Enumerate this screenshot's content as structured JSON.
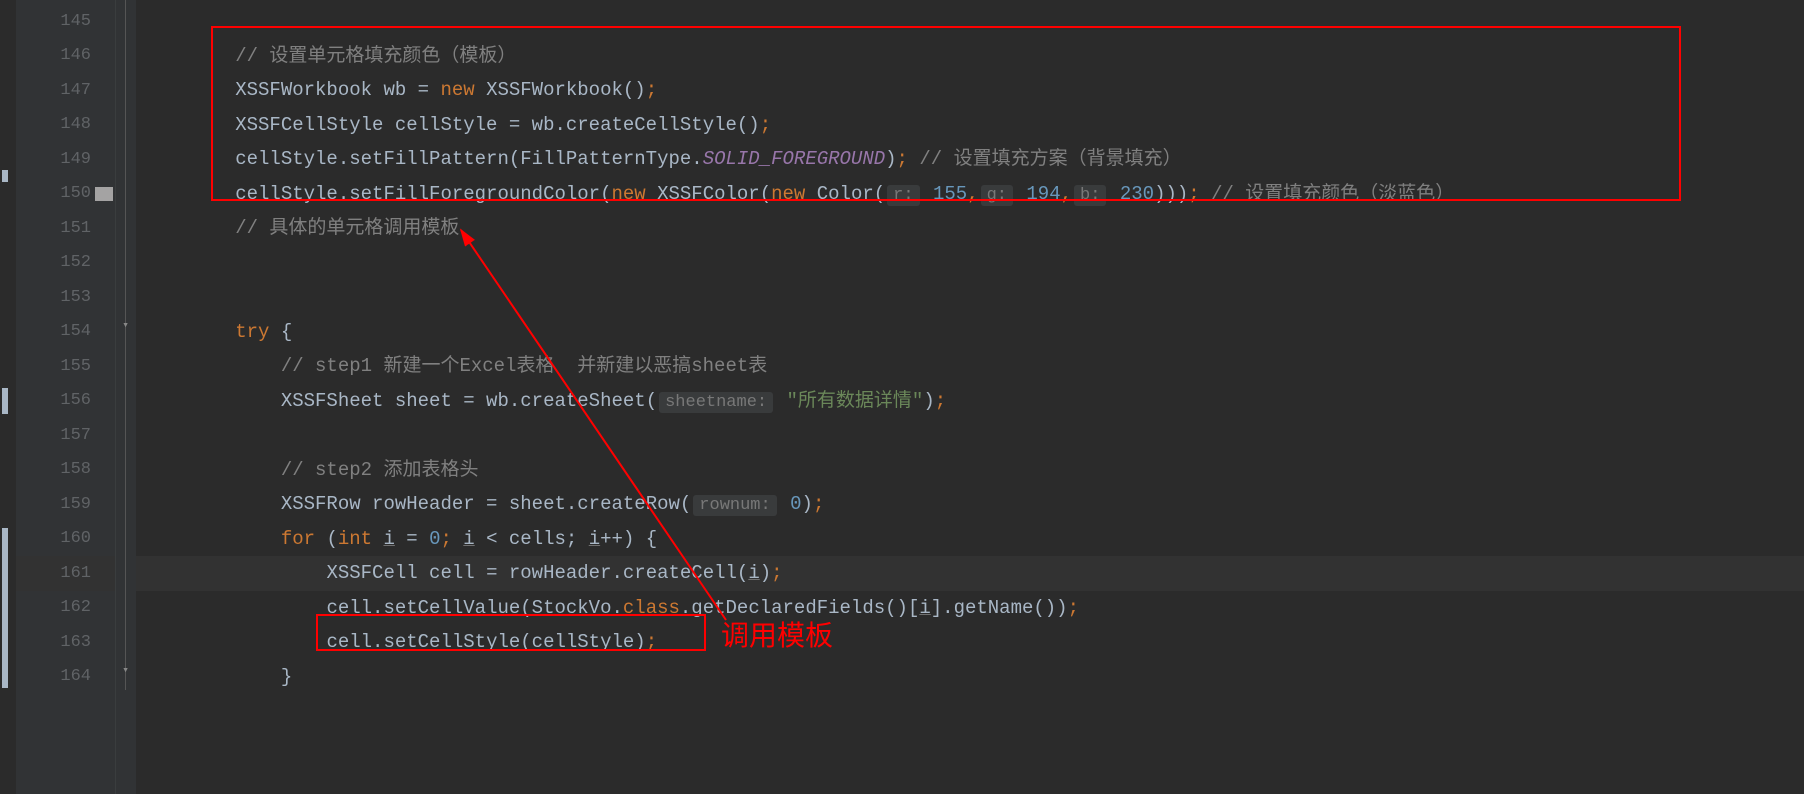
{
  "lines": [
    {
      "num": "145",
      "marker": false
    },
    {
      "num": "146",
      "marker": false
    },
    {
      "num": "147",
      "marker": false
    },
    {
      "num": "148",
      "marker": false
    },
    {
      "num": "149",
      "marker": false
    },
    {
      "num": "150",
      "marker": true
    },
    {
      "num": "151",
      "marker": false
    },
    {
      "num": "152",
      "marker": false
    },
    {
      "num": "153",
      "marker": false
    },
    {
      "num": "154",
      "marker": false
    },
    {
      "num": "155",
      "marker": false
    },
    {
      "num": "156",
      "marker": false
    },
    {
      "num": "157",
      "marker": false
    },
    {
      "num": "158",
      "marker": false
    },
    {
      "num": "159",
      "marker": false
    },
    {
      "num": "160",
      "marker": false
    },
    {
      "num": "161",
      "marker": false
    },
    {
      "num": "162",
      "marker": false
    },
    {
      "num": "163",
      "marker": false
    },
    {
      "num": "164",
      "marker": false
    }
  ],
  "code": {
    "l145": "",
    "l146_comment": "// 设置单元格填充颜色（模板）",
    "l147_t1": "XSSFWorkbook wb = ",
    "l147_kw1": "new ",
    "l147_t2": "XSSFWorkbook()",
    "l147_t3": ";",
    "l148_t1": "XSSFCellStyle cellStyle = wb.createCellStyle()",
    "l148_t2": ";",
    "l149_t1": "cellStyle.setFillPattern(FillPatternType.",
    "l149_const": "SOLID_FOREGROUND",
    "l149_t2": ")",
    "l149_t3": "; ",
    "l149_comment": "// 设置填充方案（背景填充）",
    "l150_t1": "cellStyle.setFillForegroundColor(",
    "l150_kw1": "new ",
    "l150_t2": "XSSFColor(",
    "l150_kw2": "new ",
    "l150_t3": "Color(",
    "l150_h1": "r:",
    "l150_n1": "155",
    "l150_c1": ",",
    "l150_h2": "g:",
    "l150_n2": "194",
    "l150_c2": ",",
    "l150_h3": "b:",
    "l150_n3": "230",
    "l150_t4": ")))",
    "l150_t5": "; ",
    "l150_comment": "// 设置填充颜色（淡蓝色）",
    "l151_comment": "// 具体的单元格调用模板",
    "l154_kw": "try ",
    "l154_brace": "{",
    "l155_comment": "// step1 新建一个Excel表格  并新建以恶搞sheet表",
    "l156_t1": "XSSFSheet sheet = wb.createSheet(",
    "l156_h1": "sheetname:",
    "l156_str": "\"所有数据详情\"",
    "l156_t2": ")",
    "l156_t3": ";",
    "l158_comment": "// step2 添加表格头",
    "l159_t1": "XSSFRow rowHeader = sheet.createRow(",
    "l159_h1": "rownum:",
    "l159_n1": "0",
    "l159_t2": ")",
    "l159_t3": ";",
    "l160_kw1": "for ",
    "l160_p1": "(",
    "l160_kw2": "int ",
    "l160_var1": "i",
    "l160_eq": " = ",
    "l160_n1": "0",
    "l160_sc1": "; ",
    "l160_var2": "i",
    "l160_lt": " < cells; ",
    "l160_var3": "i",
    "l160_inc": "++) {",
    "l161_t1": "XSSFCell cell = rowHeader.createCell(",
    "l161_var": "i",
    "l161_t2": ")",
    "l161_t3": ";",
    "l162_t1": "cell.setCellValue(StockVo.",
    "l162_kw": "class",
    "l162_t2": ".getDeclaredFields()[",
    "l162_var": "i",
    "l162_t3": "].getName())",
    "l162_t4": ";",
    "l163_t1": "cell.setCellStyle(cellStyle)",
    "l163_t2": ";",
    "l164_brace": "}"
  },
  "annotation_label": "调用模板"
}
